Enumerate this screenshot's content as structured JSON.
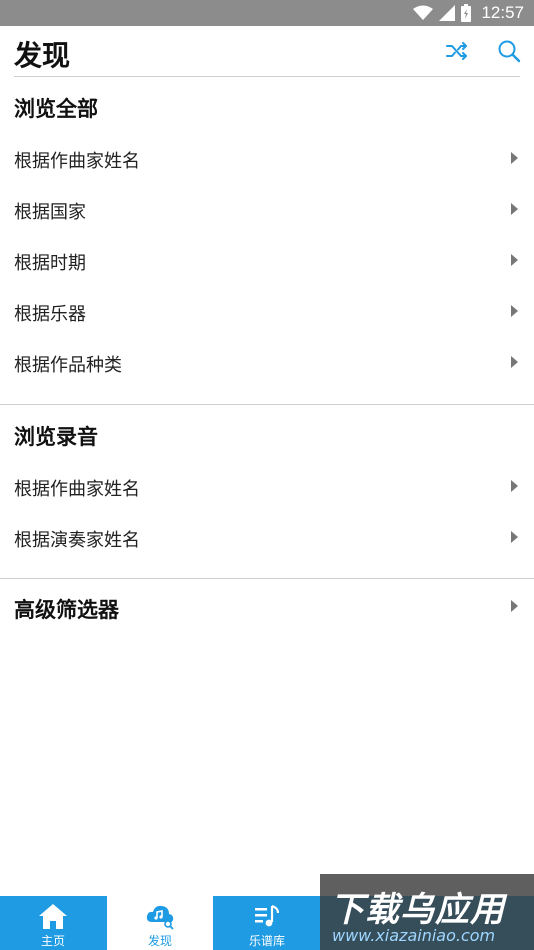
{
  "status_bar": {
    "time": "12:57"
  },
  "header": {
    "title": "发现"
  },
  "sections": [
    {
      "title": "浏览全部",
      "items": [
        {
          "label": "根据作曲家姓名"
        },
        {
          "label": "根据国家"
        },
        {
          "label": "根据时期"
        },
        {
          "label": "根据乐器"
        },
        {
          "label": "根据作品种类"
        }
      ]
    },
    {
      "title": "浏览录音",
      "items": [
        {
          "label": "根据作曲家姓名"
        },
        {
          "label": "根据演奏家姓名"
        }
      ]
    }
  ],
  "advanced": {
    "label": "高级筛选器"
  },
  "tabs": [
    {
      "label": "主页"
    },
    {
      "label": "发现"
    },
    {
      "label": "乐谱库"
    }
  ],
  "watermark": {
    "text": "下载乌应用",
    "url": "www.xiazainiao.com"
  },
  "colors": {
    "accent": "#1e9be3",
    "status_bar": "#8c8c8c"
  }
}
